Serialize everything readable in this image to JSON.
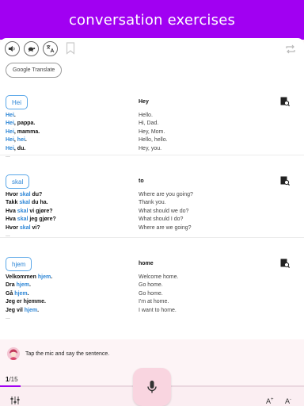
{
  "app": {
    "title": "conversation exercises",
    "accent": "#a100f2"
  },
  "toolbar": {
    "icons": [
      "speaker-icon",
      "turtle-icon",
      "translate-icon",
      "bookmark-icon",
      "repeat-icon"
    ],
    "google_translate_label": "Google Translate"
  },
  "sections": [
    {
      "word": "Hei",
      "translation": "Hey",
      "examples": [
        {
          "parts": [
            {
              "t": "Hei",
              "hl": true
            },
            {
              "t": ".",
              "hl": false
            }
          ]
        },
        {
          "parts": [
            {
              "t": "Hei",
              "hl": true
            },
            {
              "t": ", pappa.",
              "hl": false
            }
          ]
        },
        {
          "parts": [
            {
              "t": "Hei",
              "hl": true
            },
            {
              "t": ", mamma.",
              "hl": false
            }
          ]
        },
        {
          "parts": [
            {
              "t": "Hei",
              "hl": true
            },
            {
              "t": ", ",
              "hl": false
            },
            {
              "t": "hei",
              "hl": true
            },
            {
              "t": ".",
              "hl": false
            }
          ]
        },
        {
          "parts": [
            {
              "t": "Hei",
              "hl": true
            },
            {
              "t": ", du.",
              "hl": false
            }
          ]
        }
      ],
      "translations": [
        "Hello.",
        "Hi, Dad.",
        "Hey, Mom.",
        "Hello, hello.",
        "Hey, you."
      ],
      "more": "..."
    },
    {
      "word": "skal",
      "translation": "to",
      "examples": [
        {
          "parts": [
            {
              "t": "Hvor ",
              "hl": false
            },
            {
              "t": "skal",
              "hl": true
            },
            {
              "t": " du?",
              "hl": false
            }
          ]
        },
        {
          "parts": [
            {
              "t": "Takk ",
              "hl": false
            },
            {
              "t": "skal",
              "hl": true
            },
            {
              "t": " du ha.",
              "hl": false
            }
          ]
        },
        {
          "parts": [
            {
              "t": "Hva ",
              "hl": false
            },
            {
              "t": "skal",
              "hl": true
            },
            {
              "t": " vi gjøre?",
              "hl": false
            }
          ]
        },
        {
          "parts": [
            {
              "t": "Hva ",
              "hl": false
            },
            {
              "t": "skal",
              "hl": true
            },
            {
              "t": " jeg gjøre?",
              "hl": false
            }
          ]
        },
        {
          "parts": [
            {
              "t": "Hvor ",
              "hl": false
            },
            {
              "t": "skal",
              "hl": true
            },
            {
              "t": " vi?",
              "hl": false
            }
          ]
        }
      ],
      "translations": [
        "Where are you going?",
        "Thank you.",
        "What should we do?",
        "What should I do?",
        "Where are we going?"
      ],
      "more": "..."
    },
    {
      "word": "hjem",
      "translation": "home",
      "examples": [
        {
          "parts": [
            {
              "t": "Velkommen ",
              "hl": false
            },
            {
              "t": "hjem",
              "hl": true
            },
            {
              "t": ".",
              "hl": false
            }
          ]
        },
        {
          "parts": [
            {
              "t": "Dra ",
              "hl": false
            },
            {
              "t": "hjem",
              "hl": true
            },
            {
              "t": ".",
              "hl": false
            }
          ]
        },
        {
          "parts": [
            {
              "t": "Gå ",
              "hl": false
            },
            {
              "t": "hjem",
              "hl": true
            },
            {
              "t": ".",
              "hl": false
            }
          ]
        },
        {
          "parts": [
            {
              "t": "Jeg er hjemme.",
              "hl": false
            }
          ]
        },
        {
          "parts": [
            {
              "t": "Jeg vil ",
              "hl": false
            },
            {
              "t": "hjem",
              "hl": true
            },
            {
              "t": ".",
              "hl": false
            }
          ]
        }
      ],
      "translations": [
        "Welcome home.",
        "Go home.",
        "Go home.",
        "I'm at home.",
        "I want to home."
      ],
      "more": "..."
    }
  ],
  "prompt": {
    "text": "Tap the mic and say the sentence."
  },
  "progress": {
    "current": "1",
    "total": "/15",
    "fraction": 0.0667
  },
  "bottom": {
    "font_up": "A",
    "font_down": "A",
    "up_sign": "+",
    "down_sign": "-"
  }
}
